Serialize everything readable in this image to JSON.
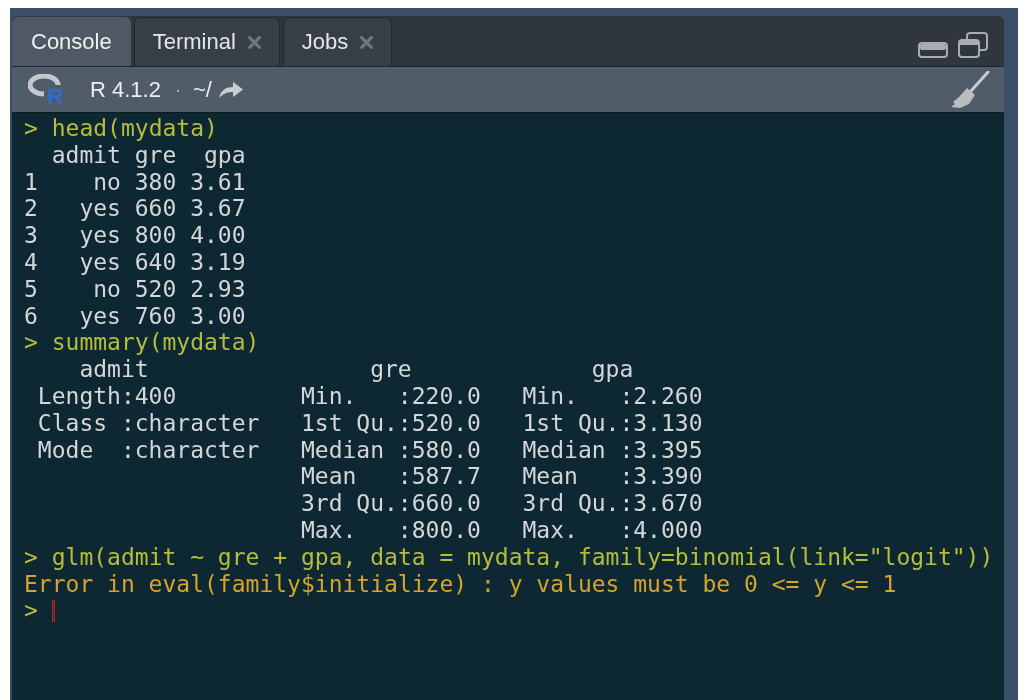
{
  "tabs": [
    {
      "label": "Console",
      "selected": true,
      "closable": false
    },
    {
      "label": "Terminal",
      "selected": false,
      "closable": true
    },
    {
      "label": "Jobs",
      "selected": false,
      "closable": true
    }
  ],
  "toolbar": {
    "logo": "R",
    "version": "R 4.1.2",
    "separator": "·",
    "path": "~/"
  },
  "console": {
    "lines": [
      {
        "kind": "input",
        "prompt": ">",
        "text": "head(mydata)"
      },
      {
        "kind": "output",
        "text": "  admit gre  gpa"
      },
      {
        "kind": "output",
        "text": "1    no 380 3.61"
      },
      {
        "kind": "output",
        "text": "2   yes 660 3.67"
      },
      {
        "kind": "output",
        "text": "3   yes 800 4.00"
      },
      {
        "kind": "output",
        "text": "4   yes 640 3.19"
      },
      {
        "kind": "output",
        "text": "5    no 520 2.93"
      },
      {
        "kind": "output",
        "text": "6   yes 760 3.00"
      },
      {
        "kind": "input",
        "prompt": ">",
        "text": "summary(mydata)"
      },
      {
        "kind": "output",
        "text": "    admit                gre             gpa"
      },
      {
        "kind": "output",
        "text": " Length:400         Min.   :220.0   Min.   :2.260"
      },
      {
        "kind": "output",
        "text": " Class :character   1st Qu.:520.0   1st Qu.:3.130"
      },
      {
        "kind": "output",
        "text": " Mode  :character   Median :580.0   Median :3.395"
      },
      {
        "kind": "output",
        "text": "                    Mean   :587.7   Mean   :3.390"
      },
      {
        "kind": "output",
        "text": "                    3rd Qu.:660.0   3rd Qu.:3.670"
      },
      {
        "kind": "output",
        "text": "                    Max.   :800.0   Max.   :4.000"
      },
      {
        "kind": "input",
        "prompt": ">",
        "text": "glm(admit ~ gre + gpa, data = mydata, family=binomial(link=\"logit\"))"
      },
      {
        "kind": "error",
        "text": "Error in eval(family$initialize) : y values must be 0 <= y <= 1"
      },
      {
        "kind": "prompt",
        "prompt": ">",
        "cursor": true
      }
    ]
  }
}
